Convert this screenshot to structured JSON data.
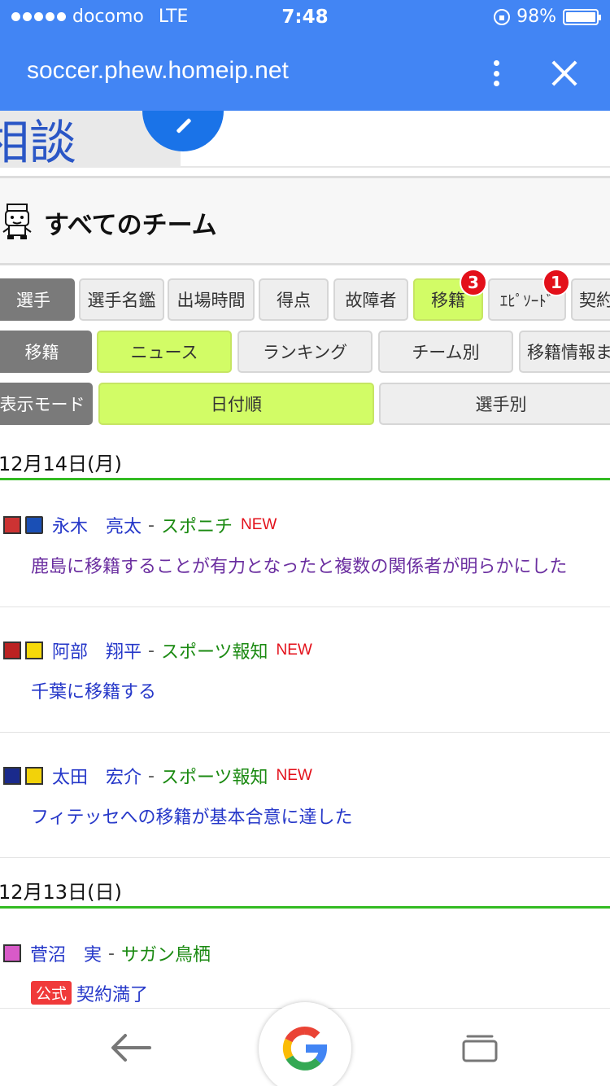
{
  "status_bar": {
    "carrier": "docomo",
    "network": "LTE",
    "time": "7:48",
    "battery": "98%"
  },
  "browser": {
    "url": "soccer.phew.homeip.net"
  },
  "banner": {
    "partial_text": "相談"
  },
  "section": {
    "title": "すべてのチーム"
  },
  "nav": {
    "row1": {
      "label": "選手",
      "buttons": [
        {
          "label": "選手名鑑",
          "badge": ""
        },
        {
          "label": "出場時間",
          "badge": ""
        },
        {
          "label": "得点",
          "badge": ""
        },
        {
          "label": "故障者",
          "badge": ""
        },
        {
          "label": "移籍",
          "badge": "3"
        },
        {
          "label": "ｴﾋﾟｿｰﾄﾞ",
          "badge": "1"
        },
        {
          "label": "契約",
          "badge": ""
        }
      ]
    },
    "row2": {
      "label": "移籍",
      "buttons": [
        {
          "label": "ニュース"
        },
        {
          "label": "ランキング"
        },
        {
          "label": "チーム別"
        },
        {
          "label": "移籍情報ま"
        }
      ]
    },
    "row3": {
      "label": "表示モード",
      "buttons": [
        {
          "label": "日付順"
        },
        {
          "label": "選手別"
        }
      ]
    }
  },
  "groups": [
    {
      "date": "12月14日(月)",
      "items": [
        {
          "player": "永木　亮太",
          "sep": "-",
          "source": "スポニチ",
          "new": "NEW",
          "text": "鹿島に移籍することが有力となったと複数の関係者が明らかにした",
          "official": ""
        },
        {
          "player": "阿部　翔平",
          "sep": "-",
          "source": "スポーツ報知",
          "new": "NEW",
          "text": "千葉に移籍する",
          "official": ""
        },
        {
          "player": "太田　宏介",
          "sep": "-",
          "source": "スポーツ報知",
          "new": "NEW",
          "text": "フィテッセへの移籍が基本合意に達した",
          "official": ""
        }
      ]
    },
    {
      "date": "12月13日(日)",
      "items": [
        {
          "player": "菅沼　実",
          "sep": "-",
          "source": "サガン鳥栖",
          "new": "",
          "text": "契約満了",
          "official": "公式"
        }
      ]
    }
  ],
  "icons": {
    "back": "back-arrow-icon",
    "google": "google-icon",
    "tabs": "tabs-icon"
  },
  "colors": {
    "header_blue": "#4285f4",
    "active_green": "#d2fc66",
    "badge_red": "#e3101a",
    "source_green": "#1b8a12",
    "link_blue": "#2638c9",
    "divider_green": "#33bb22"
  }
}
